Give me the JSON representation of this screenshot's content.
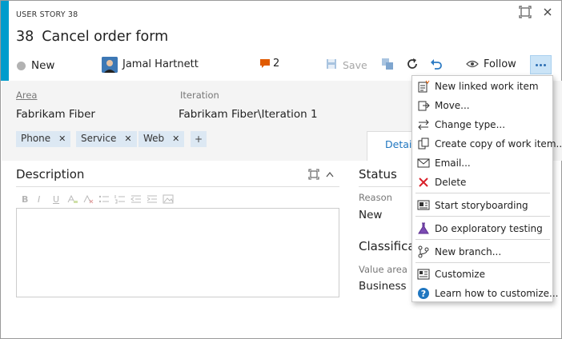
{
  "workitem": {
    "type_label": "USER STORY 38",
    "id": "38",
    "title": "Cancel order form",
    "state": "New",
    "assigned_to": "Jamal Hartnett",
    "comment_count": "2"
  },
  "toolbar": {
    "save_label": "Save",
    "follow_label": "Follow"
  },
  "fields": {
    "area_label": "Area",
    "area_value": "Fabrikam Fiber",
    "iteration_label": "Iteration",
    "iteration_value": "Fabrikam Fiber\\Iteration 1"
  },
  "tags": [
    "Phone",
    "Service",
    "Web"
  ],
  "tag_add": "+",
  "tabs": {
    "details": "Detai"
  },
  "description": {
    "title": "Description"
  },
  "status": {
    "title": "Status",
    "reason_label": "Reason",
    "reason_value": "New"
  },
  "classification": {
    "title": "Classificat",
    "value_area_label": "Value area",
    "value_area_value": "Business"
  },
  "menu": {
    "items": [
      {
        "label": "New linked work item",
        "icon": "new-linked-work-item-icon"
      },
      {
        "label": "Move...",
        "icon": "move-icon"
      },
      {
        "label": "Change type...",
        "icon": "change-type-icon"
      },
      {
        "label": "Create copy of work item...",
        "icon": "copy-icon"
      },
      {
        "label": "Email...",
        "icon": "email-icon"
      },
      {
        "label": "Delete",
        "icon": "delete-icon"
      },
      {
        "label": "Start storyboarding",
        "icon": "storyboard-icon"
      },
      {
        "label": "Do exploratory testing",
        "icon": "flask-icon"
      },
      {
        "label": "New branch...",
        "icon": "branch-icon"
      },
      {
        "label": "Customize",
        "icon": "customize-icon"
      },
      {
        "label": "Learn how to customize...",
        "icon": "help-icon"
      }
    ]
  },
  "colors": {
    "accent_bar": "#009ccc",
    "comment_icon": "#e05a00",
    "delete_icon": "#d9202a",
    "help_icon": "#1f76c0",
    "more_button_bg": "#cbe4f7",
    "link_blue": "#1f76c0"
  }
}
